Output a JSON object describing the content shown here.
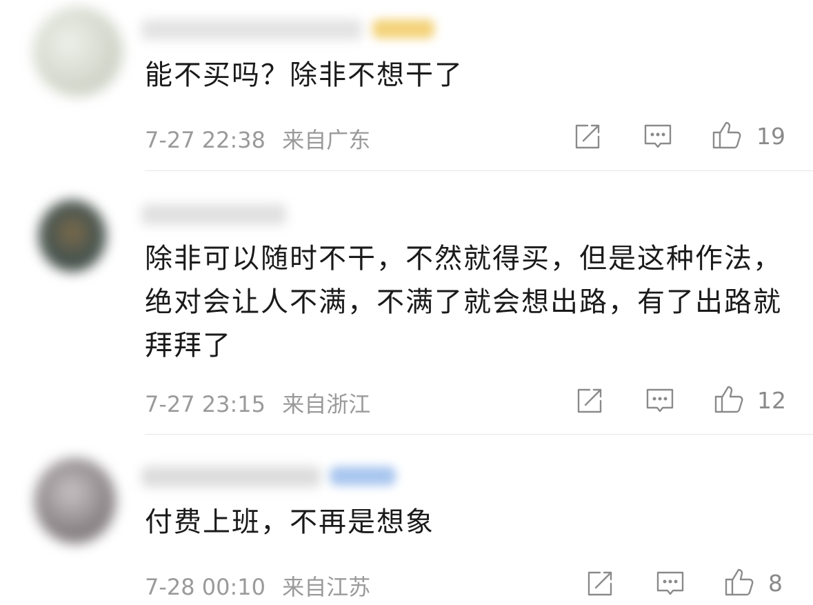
{
  "comments": [
    {
      "text": "能不买吗？除非不想干了",
      "date": "7-27 22:38",
      "location": "来自广东",
      "likes": "19",
      "avatar_color": "#d8dcd2",
      "name_color": "#e6e6e6",
      "badge_color": "#f3d27a"
    },
    {
      "text": "除非可以随时不干，不然就得买，但是这种作法，绝对会让人不满，不满了就会想出路，有了出路就拜拜了",
      "date": "7-27 23:15",
      "location": "来自浙江",
      "likes": "12",
      "avatar_color": "#4a5650",
      "name_color": "#e2e2e2"
    },
    {
      "text": "付费上班，不再是想象",
      "date": "7-28 00:10",
      "location": "来自江苏",
      "likes": "8",
      "avatar_color": "#9a9496",
      "name_color": "#dedede",
      "badge_color": "#a9c6ef"
    }
  ],
  "icons": {
    "share": "share-edit-icon",
    "reply": "comment-reply-icon",
    "like": "thumbs-up-icon"
  },
  "colors": {
    "text": "#1a1a1a",
    "meta": "#9a9a9a",
    "icon": "#8a8a8a",
    "divider": "#e6e6e6"
  }
}
